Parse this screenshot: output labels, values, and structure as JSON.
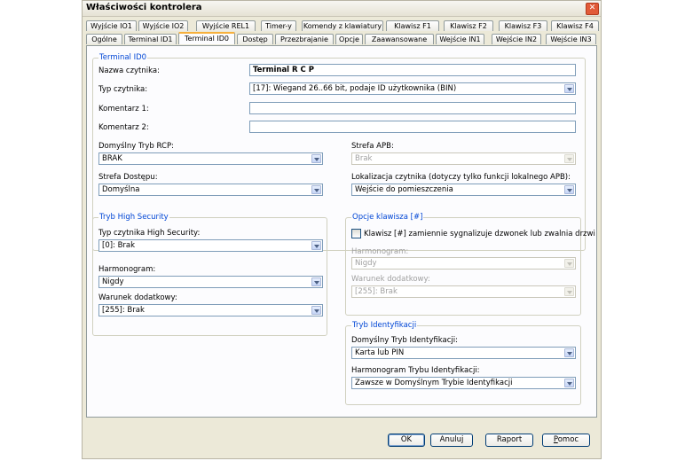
{
  "window": {
    "title": "Właściwości kontrolera"
  },
  "tabs_row1": [
    "Wyjście IO1",
    "Wyjście IO2",
    "Wyjście REL1",
    "Timer-y",
    "Komendy z klawiatury",
    "Klawisz F1",
    "Klawisz F2",
    "Klawisz F3",
    "Klawisz F4"
  ],
  "tabs_row2": [
    "Ogólne",
    "Terminal ID1",
    "Terminal ID0",
    "Dostęp",
    "Przezbrajanie",
    "Opcje",
    "Zaawansowane",
    "Wejście IN1",
    "Wejście IN2",
    "Wejście IN3"
  ],
  "active_tab": "Terminal ID0",
  "terminal": {
    "legend": "Terminal ID0",
    "name_label": "Nazwa czytnika:",
    "name_value": "Terminal R C P",
    "type_label": "Typ czytnika:",
    "type_value": "[17]: Wiegand 26..66 bit, podaje ID użytkownika (BIN)",
    "comment1_label": "Komentarz 1:",
    "comment1_value": "",
    "comment2_label": "Komentarz 2:",
    "comment2_value": "",
    "rcp_label": "Domyślny Tryb RCP:",
    "rcp_value": "BRAK",
    "apb_label": "Strefa APB:",
    "apb_value": "Brak",
    "zone_label": "Strefa Dostępu:",
    "zone_value": "Domyślna",
    "location_label": "Lokalizacja czytnika (dotyczy tylko funkcji lokalnego APB):",
    "location_value": "Wejście do pomieszczenia"
  },
  "high_security": {
    "legend": "Tryb High Security",
    "type_label": "Typ czytnika High Security:",
    "type_value": "[0]: Brak",
    "schedule_label": "Harmonogram:",
    "schedule_value": "Nigdy",
    "condition_label": "Warunek dodatkowy:",
    "condition_value": "[255]: Brak"
  },
  "key_options": {
    "legend": "Opcje klawisza [#]",
    "checkbox_label": "Klawisz [#] zamiennie sygnalizuje dzwonek lub zwalnia drzwi",
    "checked": false,
    "schedule_label": "Harmonogram:",
    "schedule_value": "Nigdy",
    "condition_label": "Warunek dodatkowy:",
    "condition_value": "[255]: Brak"
  },
  "identification": {
    "legend": "Tryb Identyfikacji",
    "mode_label": "Domyślny Tryb Identyfikacji:",
    "mode_value": "Karta lub PIN",
    "schedule_label": "Harmonogram Trybu Identyfikacji:",
    "schedule_value": "Zawsze w Domyślnym Trybie Identyfikacji"
  },
  "buttons": {
    "ok": "OK",
    "cancel": "Anuluj",
    "report": "Raport",
    "help_accel": "P",
    "help_rest": "omoc"
  }
}
